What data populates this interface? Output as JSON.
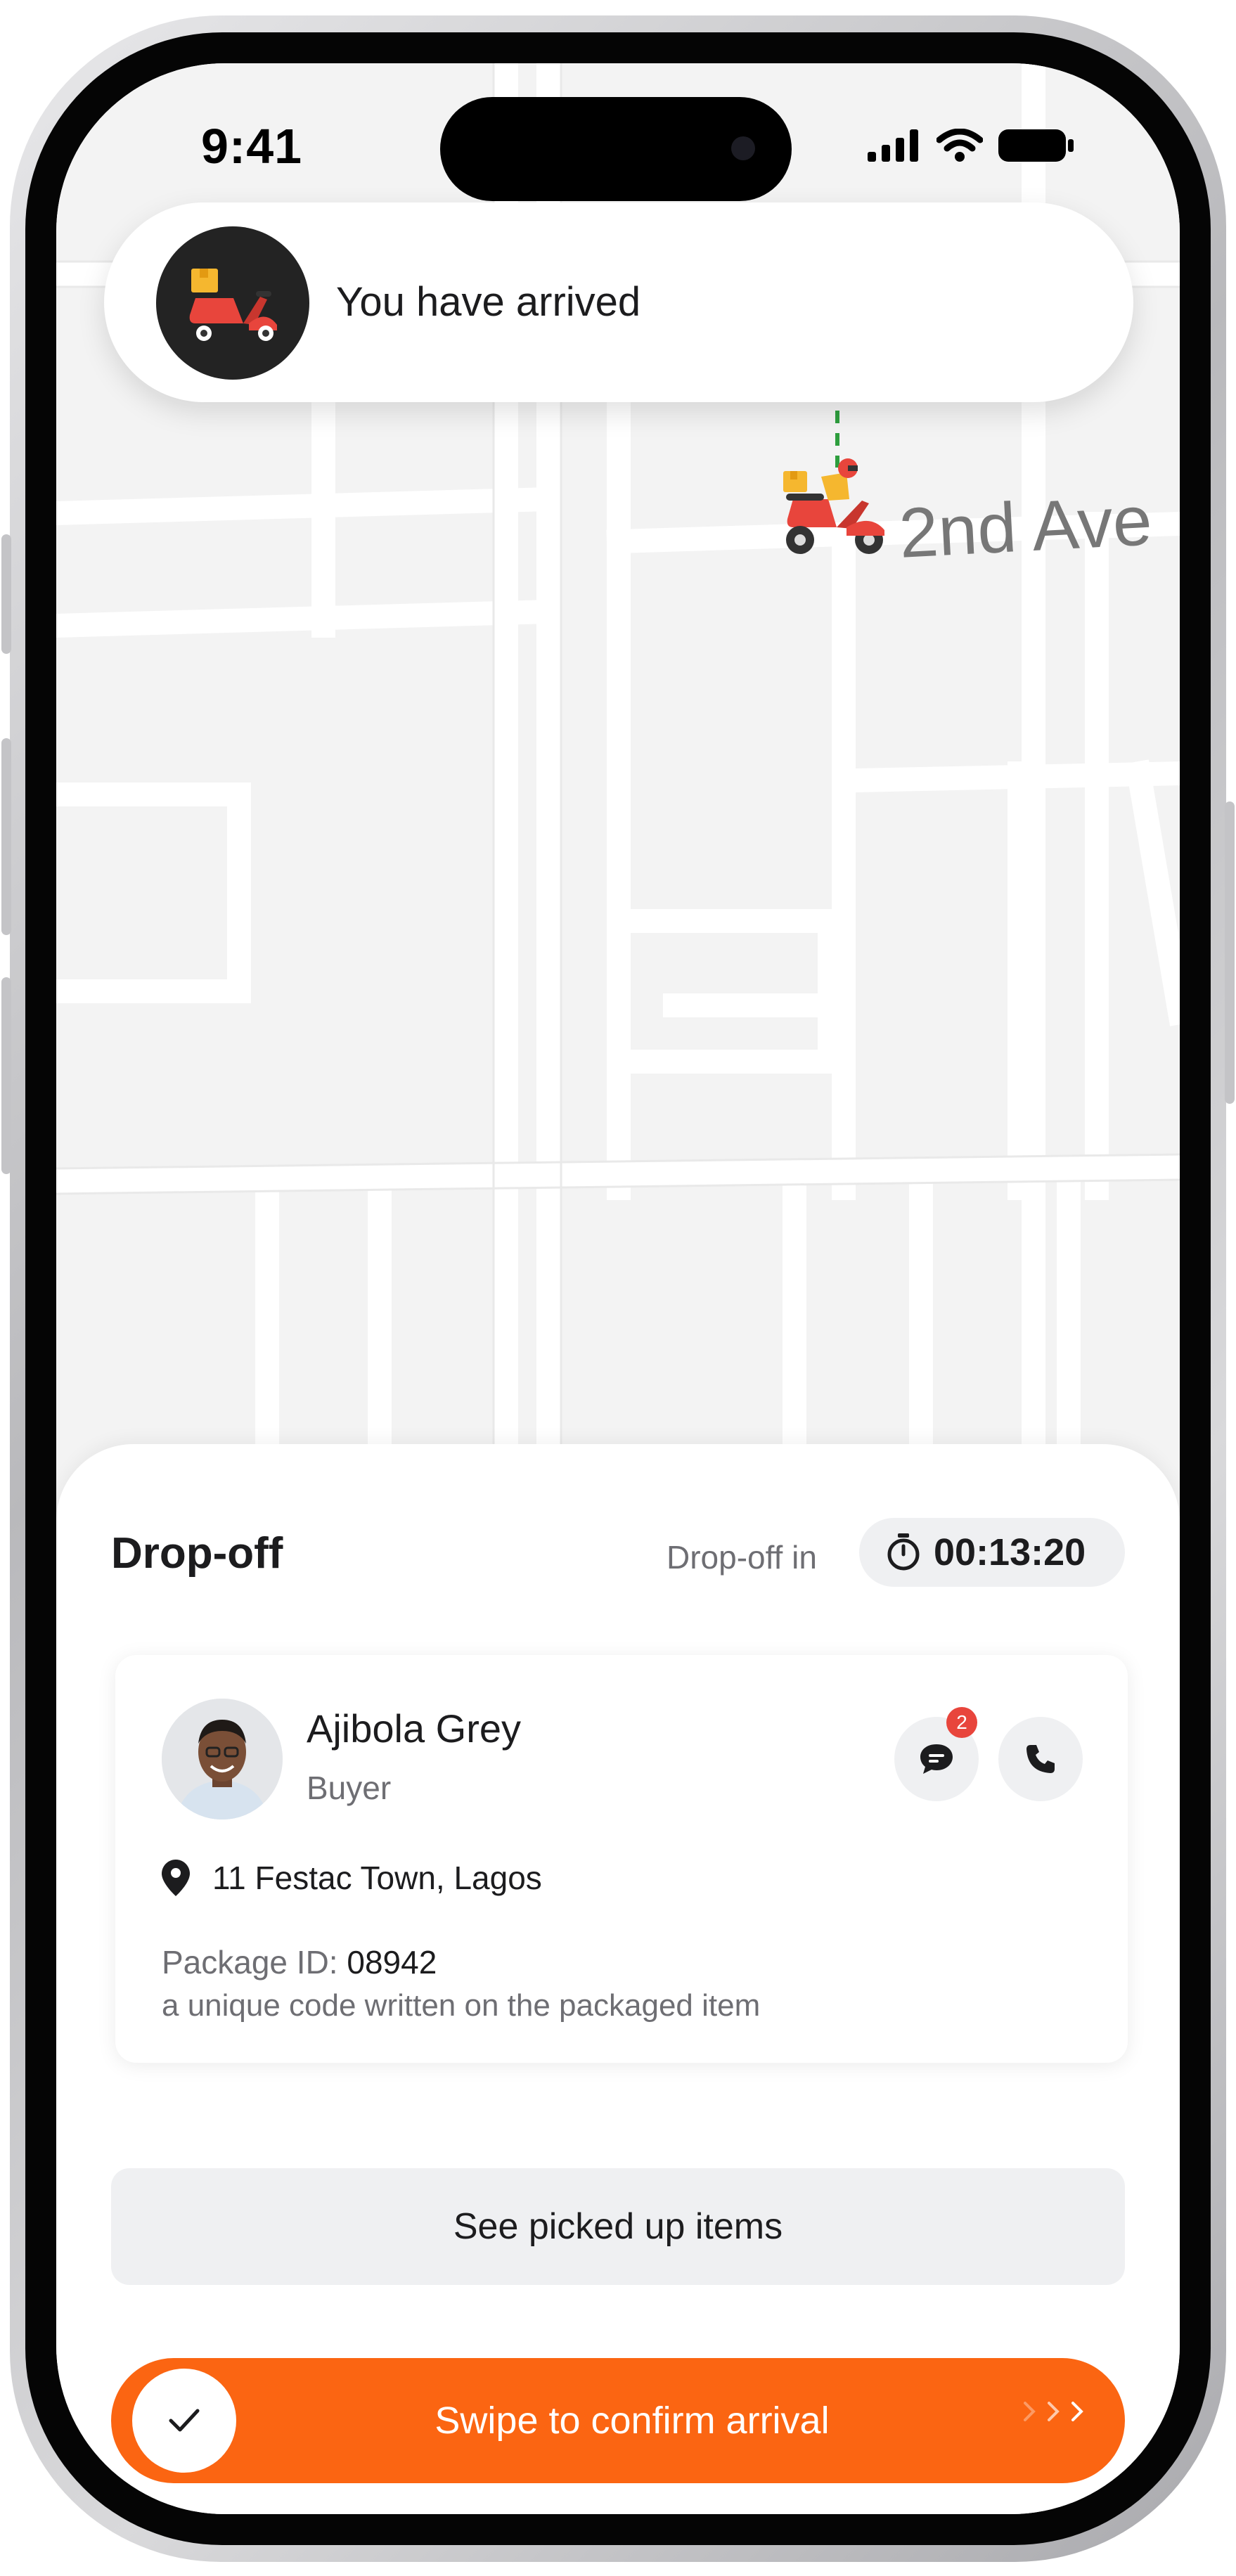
{
  "status_bar": {
    "time": "9:41"
  },
  "notification": {
    "message": "You have arrived",
    "icon": "scooter-icon"
  },
  "map": {
    "street_label": "2nd Ave",
    "rider_icon": "delivery-rider-icon",
    "route_color": "#2e9e3e"
  },
  "sheet": {
    "title": "Drop-off",
    "dropoff_label": "Drop-off in",
    "timer": "00:13:20",
    "buyer": {
      "name": "Ajibola Grey",
      "role": "Buyer",
      "unread_messages": "2",
      "address": "11 Festac Town, Lagos"
    },
    "package": {
      "id_label": "Package ID:",
      "id_value": "08942",
      "hint": "a unique code written on the packaged item"
    },
    "picked_items_label": "See picked up items",
    "swipe_label": "Swipe to confirm arrival"
  },
  "colors": {
    "accent": "#fb6512",
    "badge": "#e8453c",
    "scooter": "#e8453c",
    "box": "#f5b72f"
  }
}
